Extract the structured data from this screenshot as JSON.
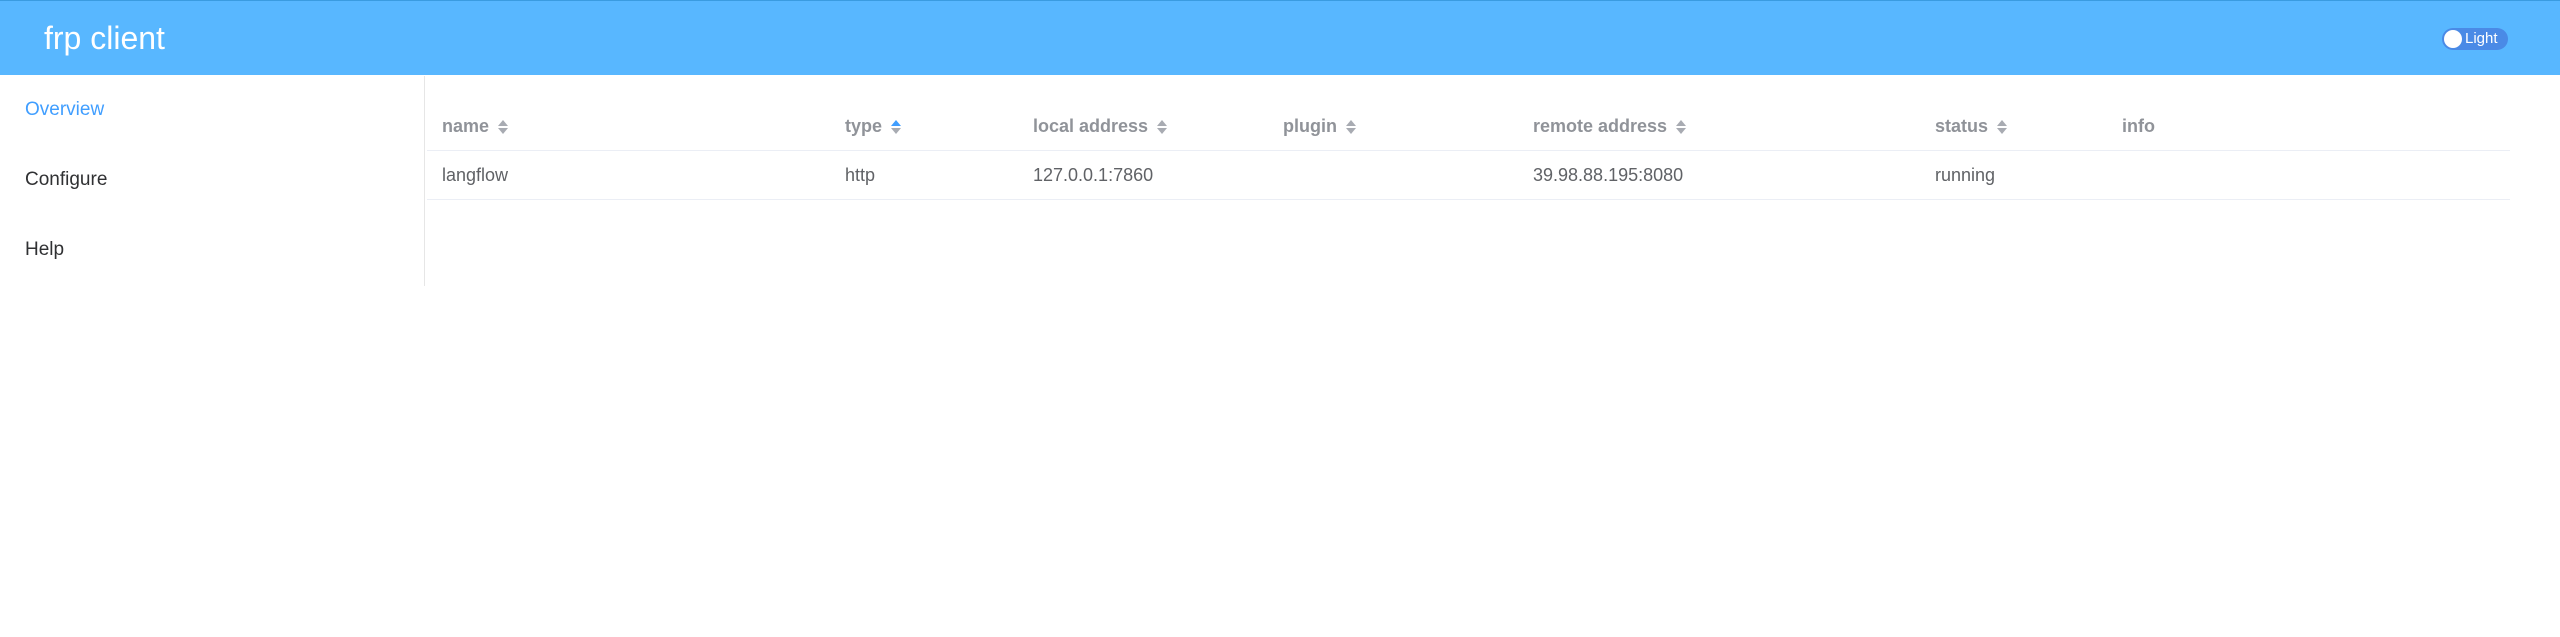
{
  "header": {
    "title": "frp client",
    "theme_switch_label": "Light"
  },
  "sidebar": {
    "items": [
      {
        "label": "Overview",
        "active": true
      },
      {
        "label": "Configure",
        "active": false
      },
      {
        "label": "Help",
        "active": false
      }
    ]
  },
  "table": {
    "columns": [
      {
        "label": "name",
        "sortable": true,
        "sort_active": false
      },
      {
        "label": "type",
        "sortable": true,
        "sort_active": true
      },
      {
        "label": "local address",
        "sortable": true,
        "sort_active": false
      },
      {
        "label": "plugin",
        "sortable": true,
        "sort_active": false
      },
      {
        "label": "remote address",
        "sortable": true,
        "sort_active": false
      },
      {
        "label": "status",
        "sortable": true,
        "sort_active": false
      },
      {
        "label": "info",
        "sortable": false,
        "sort_active": false
      }
    ],
    "rows": [
      {
        "name": "langflow",
        "type": "http",
        "local_address": "127.0.0.1:7860",
        "plugin": "",
        "remote_address": "39.98.88.195:8080",
        "status": "running",
        "info": ""
      }
    ]
  },
  "colors": {
    "header_bg": "#58b7ff",
    "accent": "#409eff"
  }
}
